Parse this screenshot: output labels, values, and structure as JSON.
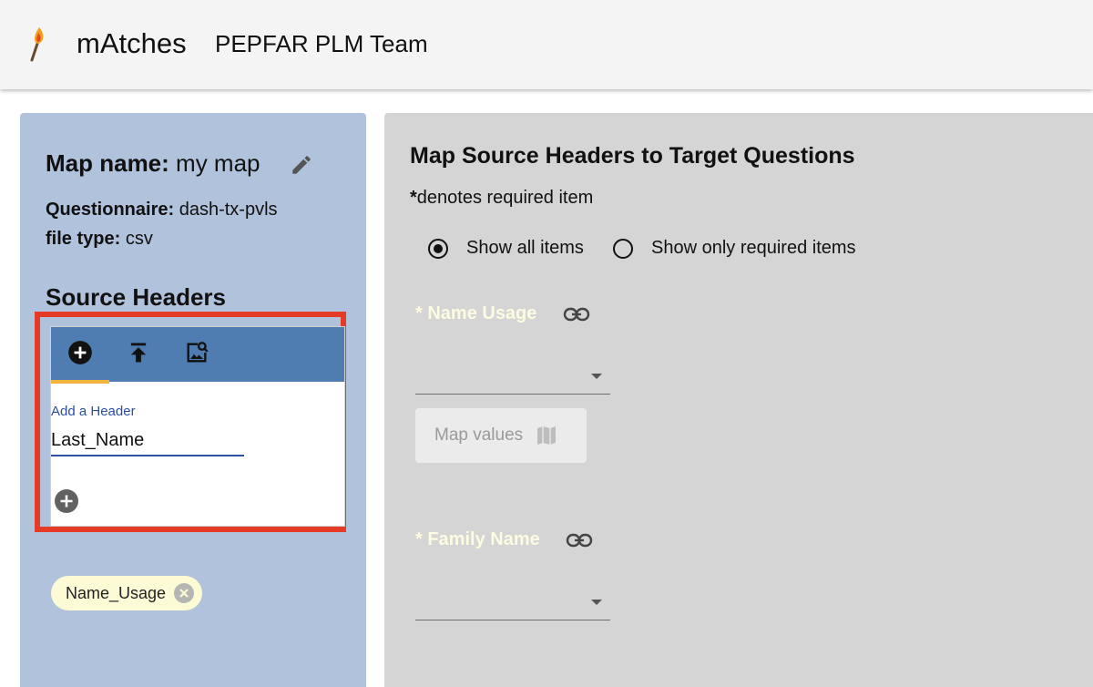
{
  "appbar": {
    "app_name": "mAtches",
    "team_name": "PEPFAR PLM Team",
    "logo_icon": "match-logo-icon"
  },
  "sidebar": {
    "map_name_label": "Map name:",
    "map_name_value": "my map",
    "questionnaire_label": "Questionnaire:",
    "questionnaire_value": "dash-tx-pvls",
    "file_type_label": "file type:",
    "file_type_value": "csv",
    "source_headers_title": "Source Headers",
    "tabs": [
      {
        "icon": "add-circle-icon",
        "active": true
      },
      {
        "icon": "upload-icon",
        "active": false
      },
      {
        "icon": "image-search-icon",
        "active": false
      }
    ],
    "add_header_label": "Add a Header",
    "add_header_value": "Last_Name",
    "chips": [
      {
        "label": "Name_Usage"
      }
    ]
  },
  "main": {
    "title": "Map Source Headers to Target Questions",
    "required_mark": "*",
    "required_note": "denotes required item",
    "radio_options": [
      {
        "label": "Show all items",
        "checked": true
      },
      {
        "label": "Show only required items",
        "checked": false
      }
    ],
    "questions": [
      {
        "label": "* Name Usage",
        "selected": "",
        "map_values_label": "Map values"
      },
      {
        "label": "* Family Name",
        "selected": ""
      }
    ]
  },
  "colors": {
    "sidebar_bg": "#b1c2dc",
    "tabbar_bg": "#4f7cb1",
    "tab_indicator": "#f3b23c",
    "highlight_border": "#e53a25",
    "main_bg": "#d5d5d5",
    "chip_bg": "#fdfbd6",
    "question_label": "#fdfbe0"
  }
}
